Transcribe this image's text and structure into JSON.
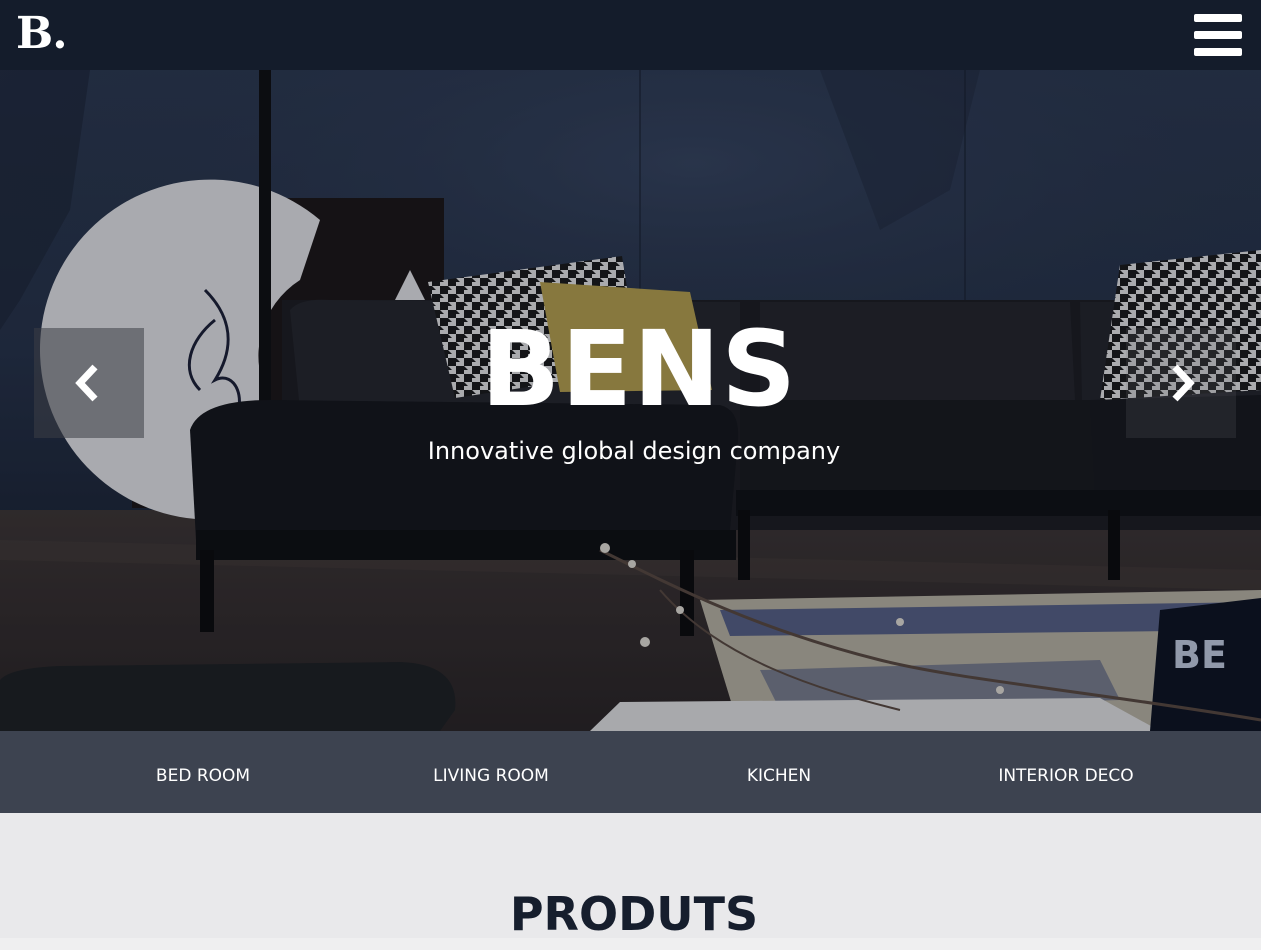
{
  "header": {
    "logo_text": "B.",
    "menu_icon": "hamburger-menu-icon"
  },
  "hero": {
    "title": "BENS",
    "subtitle": "Innovative global design company",
    "prev_icon": "chevron-left-icon",
    "next_icon": "chevron-right-icon"
  },
  "categories": {
    "items": [
      {
        "label": "BED ROOM"
      },
      {
        "label": "LIVING ROOM"
      },
      {
        "label": "KICHEN"
      },
      {
        "label": "INTERIOR DECO"
      }
    ]
  },
  "products": {
    "title": "PRODUTS"
  },
  "colors": {
    "header_bg": "#141c2b",
    "category_bar_bg": "#3d4350",
    "section_bg": "#e9e9eb",
    "heading_text": "#161e2d"
  }
}
